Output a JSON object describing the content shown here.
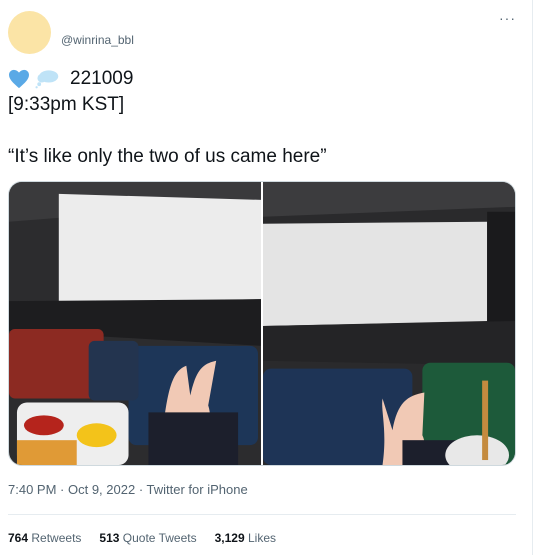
{
  "author": {
    "handle": "@winrina_bbl"
  },
  "tweet": {
    "date_code": "221009",
    "time_line": "[9:33pm KST]",
    "quote": "“It’s like only the two of us came here”",
    "icons": [
      "blue-heart-icon",
      "thought-balloon-icon"
    ]
  },
  "meta": {
    "time": "7:40 PM",
    "sep1": " · ",
    "date": "Oct 9, 2022",
    "sep2": " · ",
    "source": "Twitter for iPhone"
  },
  "stats": {
    "retweets_count": "764",
    "retweets_label": "Retweets",
    "quotes_count": "513",
    "quotes_label": "Quote Tweets",
    "likes_count": "3,129",
    "likes_label": "Likes"
  },
  "more_label": "···",
  "colors": {
    "heart": "#5aa9e6",
    "cloud": "#bfe3f7",
    "muted": "#536471",
    "avatar": "#fbe4a6"
  }
}
